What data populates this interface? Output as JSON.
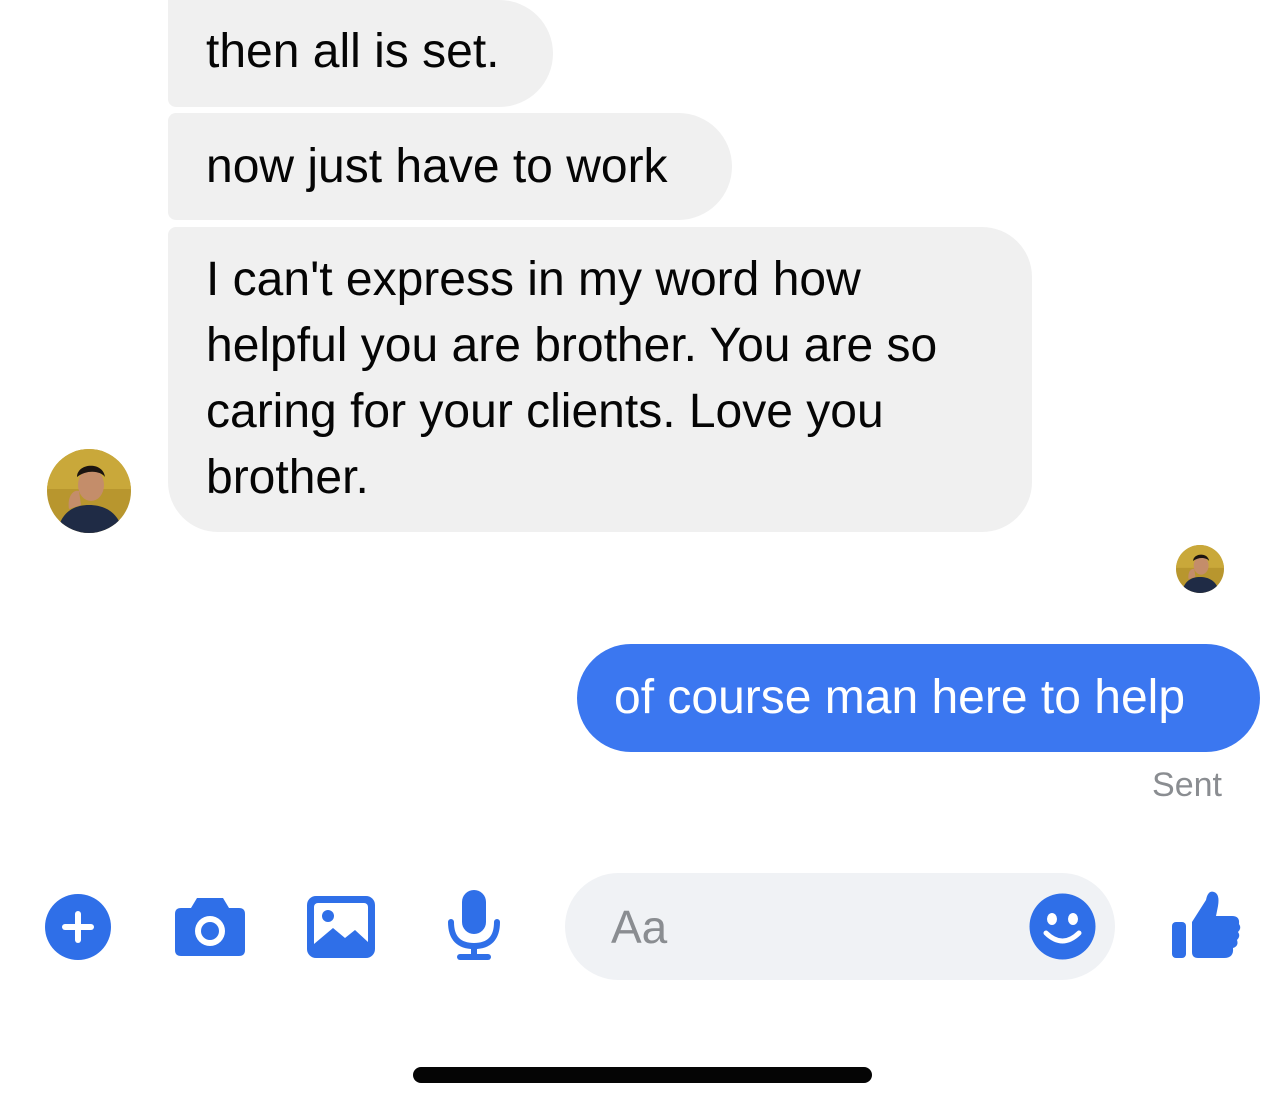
{
  "thread": {
    "incoming": [
      {
        "text": "then all is set."
      },
      {
        "text": "now just have to work"
      },
      {
        "text": "I can't express in my word how helpful you are brother. You are so caring for your clients. Love you brother."
      }
    ],
    "outgoing": [
      {
        "text": "of course man here to help",
        "status": "Sent"
      }
    ]
  },
  "composer": {
    "placeholder": "Aa"
  },
  "toolbar": {
    "icons": [
      "plus-icon",
      "camera-icon",
      "image-icon",
      "microphone-icon",
      "emoji-icon",
      "thumbs-up-icon"
    ]
  },
  "colors": {
    "accent": "#3b77f0",
    "icon_blue": "#2f6fe8",
    "incoming_bubble": "#f0f0f0",
    "composer_bg": "#f0f2f5",
    "status_gray": "#8a8d91"
  }
}
